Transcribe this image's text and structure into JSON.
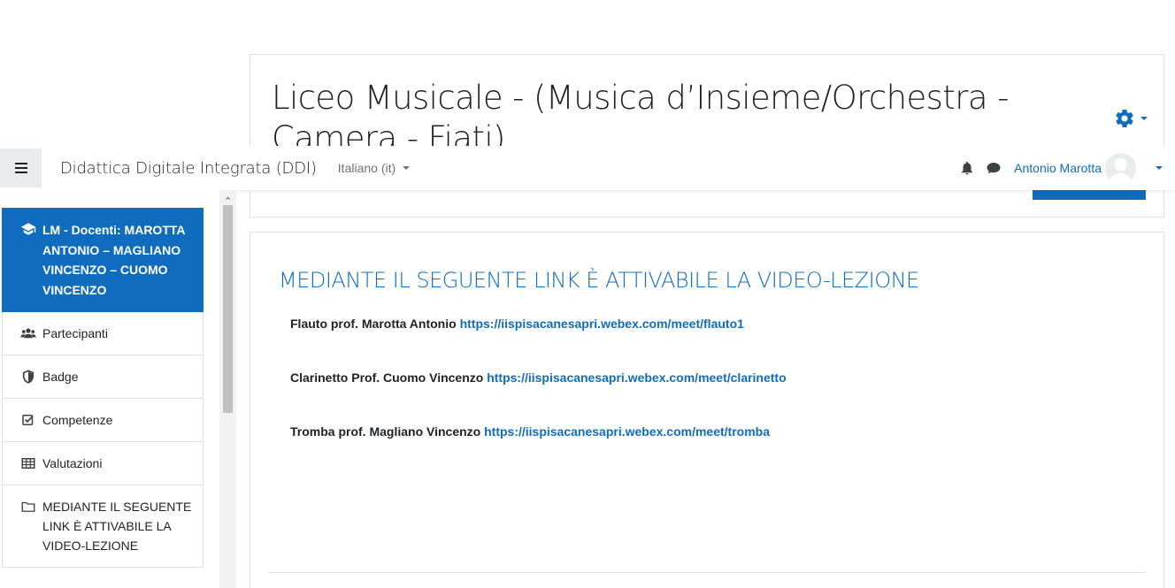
{
  "header": {
    "title": "Liceo Musicale - (Musica d’Insieme/Orchestra - Camera - Fiati)",
    "settings_icon": "gear-icon"
  },
  "navbar": {
    "site_name": "Didattica Digitale Integrata (DDI)",
    "language": "Italiano (it)",
    "user_name": "Antonio Marotta",
    "icons": [
      "hamburger-icon",
      "bell-icon",
      "chat-icon",
      "avatar"
    ]
  },
  "drawer": {
    "course": "LM - Docenti: MAROTTA ANTONIO – MAGLIANO VINCENZO – CUOMO VINCENZO",
    "items": [
      {
        "label": "Partecipanti",
        "icon": "users-icon"
      },
      {
        "label": "Badge",
        "icon": "shield-icon"
      },
      {
        "label": "Competenze",
        "icon": "checkbox-icon"
      },
      {
        "label": "Valutazioni",
        "icon": "table-icon"
      },
      {
        "label": "MEDIANTE IL SEGUENTE LINK È ATTIVABILE LA VIDEO-LEZIONE",
        "icon": "folder-icon"
      }
    ]
  },
  "content": {
    "section_title": "MEDIANTE IL SEGUENTE LINK È ATTIVABILE LA VIDEO-LEZIONE",
    "links": [
      {
        "label": "Flauto prof. Marotta Antonio",
        "url": "https://iispisacanesapri.webex.com/meet/flauto1"
      },
      {
        "label": "Clarinetto Prof. Cuomo Vincenzo",
        "url": "https://iispisacanesapri.webex.com/meet/clarinetto"
      },
      {
        "label": "Tromba prof. Magliano Vincenzo",
        "url": "https://iispisacanesapri.webex.com/meet/tromba"
      }
    ]
  },
  "colors": {
    "brand": "#0f6cbf",
    "text": "#1d2125",
    "muted": "#6a737b"
  }
}
